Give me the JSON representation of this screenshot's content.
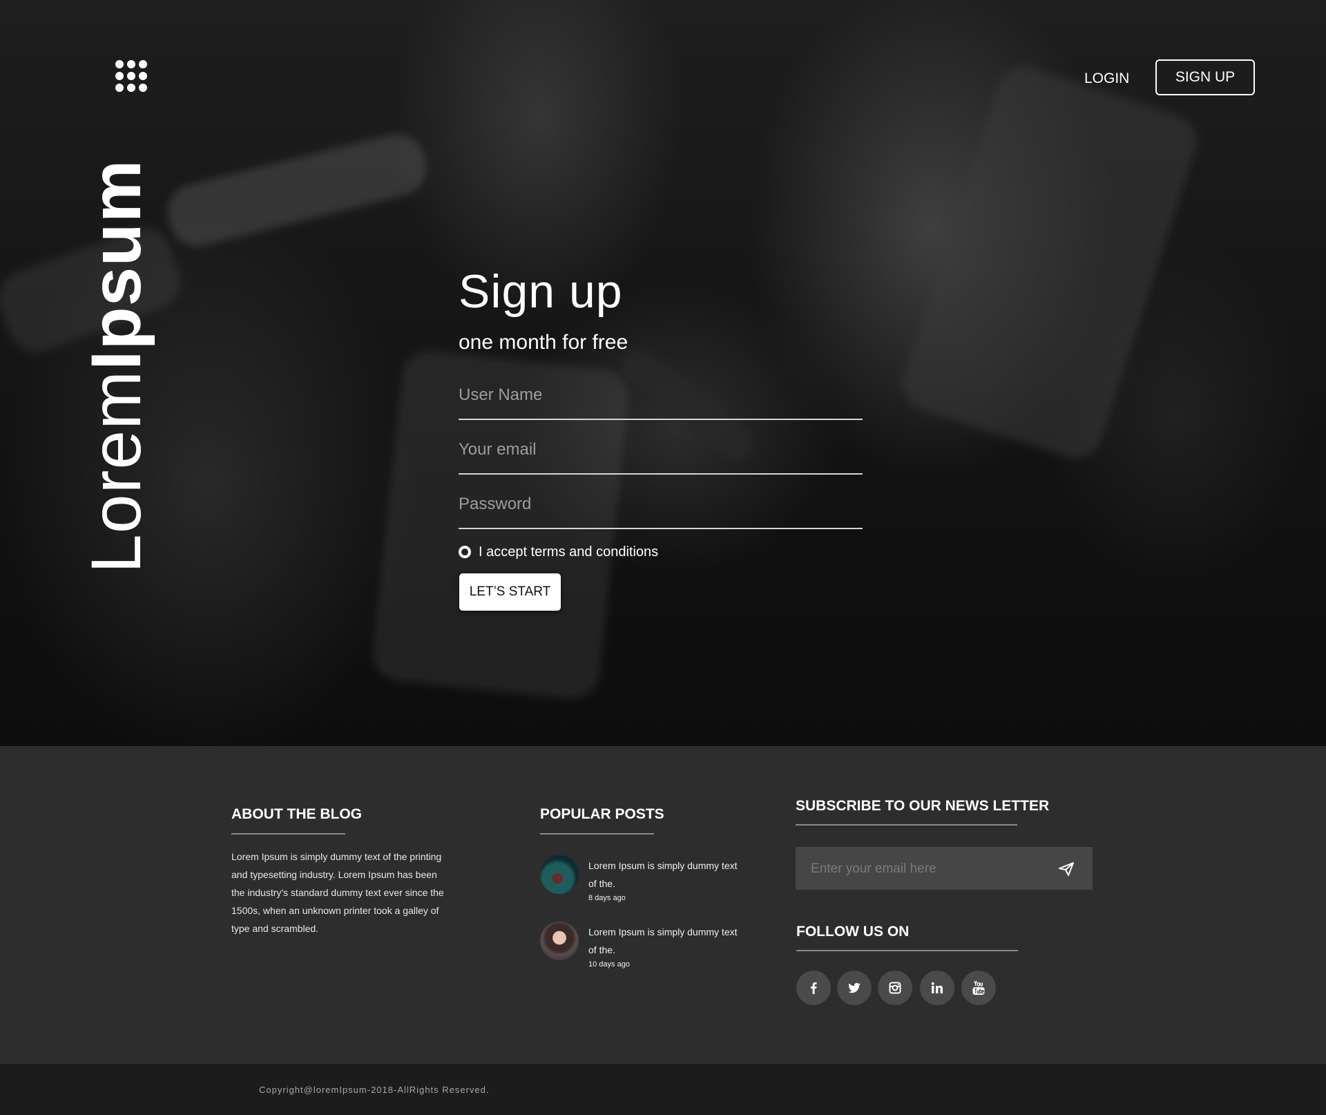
{
  "brand": {
    "light": "Lorem",
    "bold": "Ipsum"
  },
  "nav": {
    "login": "LOGIN",
    "signup": "SIGN UP"
  },
  "signup_form": {
    "title": "Sign up",
    "subtitle": "one month for free",
    "username_placeholder": "User Name",
    "email_placeholder": "Your email",
    "password_placeholder": "Password",
    "terms_label": "I accept terms and conditions",
    "submit_label": "LET’S START"
  },
  "footer": {
    "about": {
      "title": "ABOUT THE BLOG",
      "text": "Lorem Ipsum is simply dummy text of the printing and typesetting industry. Lorem Ipsum has been the industry's standard dummy text ever since the 1500s, when an unknown printer took a galley of type and scrambled."
    },
    "popular": {
      "title": "POPULAR POSTS",
      "posts": [
        {
          "text": "Lorem Ipsum is simply dummy text of the.",
          "date": "8 days ago"
        },
        {
          "text": "Lorem Ipsum is simply dummy text of the.",
          "date": "10 days ago"
        }
      ]
    },
    "subscribe": {
      "title": "SUBSCRIBE TO OUR NEWS LETTER",
      "placeholder": "Enter your email here"
    },
    "follow": {
      "title": "FOLLOW US ON",
      "networks": [
        "facebook-icon",
        "twitter-icon",
        "instagram-icon",
        "linkedin-icon",
        "youtube-icon"
      ]
    },
    "copyright": "Copyright@loremIpsum-2018-AllRights Reserved."
  },
  "colors": {
    "footer_bg": "#2d2d2e",
    "footer_bottom_bg": "#1c1c1d",
    "social_circle": "#4a4a4b",
    "input_box": "#464647"
  }
}
